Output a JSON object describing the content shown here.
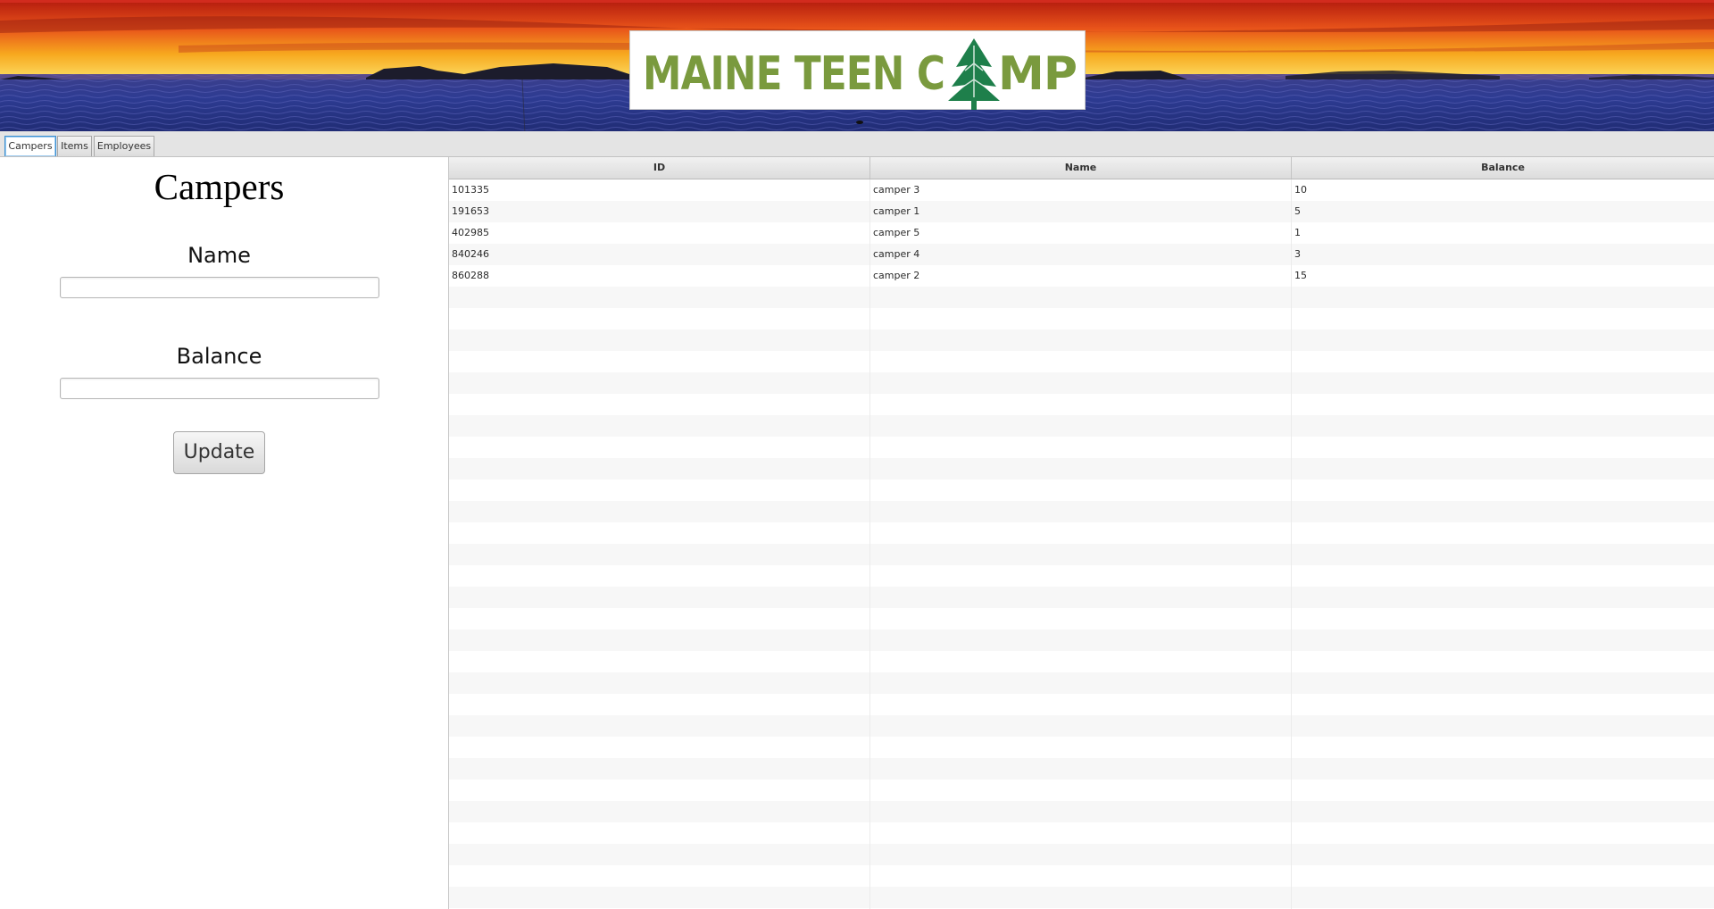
{
  "banner": {
    "logo_text": "MAINE TEEN CAMP",
    "colors": {
      "sky_top": "#e8491a",
      "sky_horizon": "#f7c21f",
      "water": "#2b3a8c",
      "logo_green": "#7a9a3e",
      "tree_green": "#1e7f4b",
      "top_border": "#d22b1e"
    }
  },
  "tabs": [
    {
      "label": "Campers",
      "active": true
    },
    {
      "label": "Items",
      "active": false
    },
    {
      "label": "Employees",
      "active": false
    }
  ],
  "form": {
    "title": "Campers",
    "name_label": "Name",
    "name_value": "",
    "balance_label": "Balance",
    "balance_value": "",
    "update_label": "Update"
  },
  "table": {
    "columns": [
      "ID",
      "Name",
      "Balance"
    ],
    "rows": [
      [
        "101335",
        "camper 3",
        "10"
      ],
      [
        "191653",
        "camper 1",
        "5"
      ],
      [
        "402985",
        "camper 5",
        "1"
      ],
      [
        "840246",
        "camper 4",
        "3"
      ],
      [
        "860288",
        "camper 2",
        "15"
      ]
    ]
  }
}
